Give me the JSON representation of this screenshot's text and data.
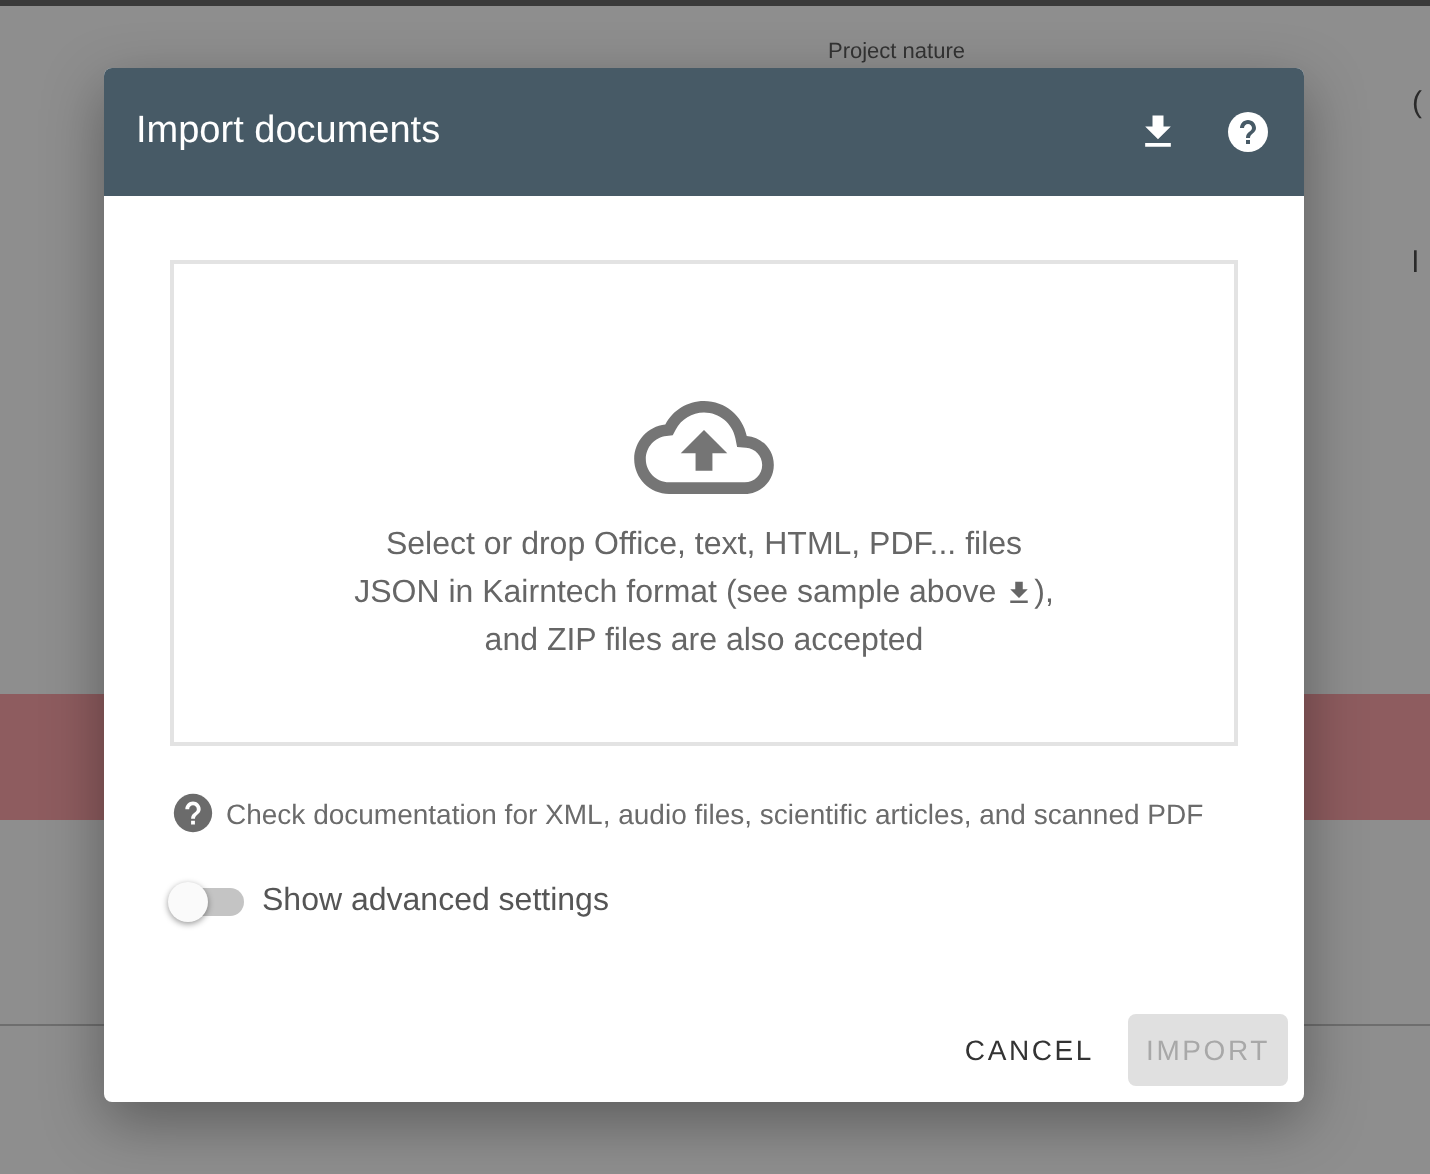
{
  "background": {
    "field_label": "Project nature",
    "edge_texts": [
      "(",
      "l"
    ]
  },
  "dialog": {
    "title": "Import documents",
    "dropzone": {
      "line_1": "Select or drop Office, text, HTML, PDF... files",
      "line_2_before": "JSON in Kairntech format (see sample above",
      "line_2_after": "),",
      "line_3": "and ZIP files are also accepted"
    },
    "help_text": "Check documentation for XML, audio files, scientific articles, and scanned PDF",
    "advanced_toggle": {
      "label": "Show advanced settings",
      "on": false
    },
    "buttons": [
      {
        "label": "CANCEL",
        "disabled": false
      },
      {
        "label": "IMPORT",
        "disabled": true
      }
    ]
  }
}
